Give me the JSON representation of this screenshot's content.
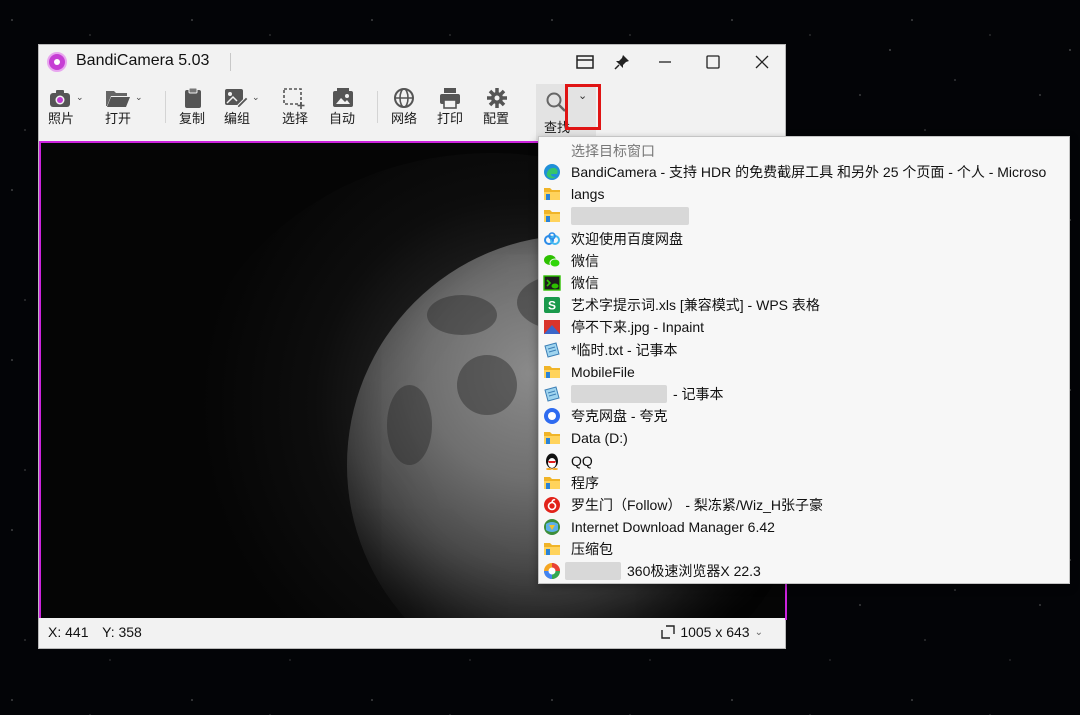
{
  "window": {
    "title": "BandiCamera 5.03",
    "accent": "#cc22dd"
  },
  "toolbar": {
    "items": [
      {
        "label": "照片",
        "icon": "camera-icon"
      },
      {
        "label": "打开",
        "icon": "folder-open-icon"
      },
      {
        "label": "复制",
        "icon": "clipboard-icon"
      },
      {
        "label": "编组",
        "icon": "edit-image-icon"
      },
      {
        "label": "选择",
        "icon": "select-region-icon"
      },
      {
        "label": "自动",
        "icon": "auto-capture-icon"
      },
      {
        "label": "网络",
        "icon": "globe-icon"
      },
      {
        "label": "打印",
        "icon": "printer-icon"
      },
      {
        "label": "配置",
        "icon": "gear-icon"
      },
      {
        "label": "查找",
        "icon": "search-icon"
      }
    ]
  },
  "statusbar": {
    "x_label": "X: 441",
    "y_label": "Y: 358",
    "size_label": "1005 x 643"
  },
  "dropdown": {
    "header": "选择目标窗口",
    "items": [
      {
        "label": "BandiCamera - 支持 HDR 的免费截屏工具 和另外 25 个页面 - 个人 - Microso",
        "icon": "edge-icon"
      },
      {
        "label": "langs",
        "icon": "folder-icon"
      },
      {
        "label": "",
        "icon": "folder-icon"
      },
      {
        "label": "欢迎使用百度网盘",
        "icon": "baidu-netdisk-icon"
      },
      {
        "label": "微信",
        "icon": "wechat-icon"
      },
      {
        "label": "微信",
        "icon": "terminal-icon"
      },
      {
        "label": "艺术字提示词.xls [兼容模式] - WPS 表格",
        "icon": "wps-sheet-icon"
      },
      {
        "label": "停不下来.jpg - Inpaint",
        "icon": "inpaint-icon"
      },
      {
        "label": "*临时.txt - 记事本",
        "icon": "notepad-icon"
      },
      {
        "label": "MobileFile",
        "icon": "folder-icon"
      },
      {
        "label": "- 记事本",
        "icon": "notepad-icon"
      },
      {
        "label": "夸克网盘 - 夸克",
        "icon": "quark-icon"
      },
      {
        "label": "Data (D:)",
        "icon": "folder-icon"
      },
      {
        "label": "QQ",
        "icon": "qq-penguin-icon"
      },
      {
        "label": "程序",
        "icon": "folder-icon"
      },
      {
        "label": "罗生门（Follow） - 梨冻紧/Wiz_H张子豪",
        "icon": "netease-music-icon"
      },
      {
        "label": "Internet Download Manager 6.42",
        "icon": "idm-icon"
      },
      {
        "label": "压缩包",
        "icon": "folder-icon"
      },
      {
        "label": "360极速浏览器X 22.3",
        "icon": "browser-360-icon"
      }
    ]
  }
}
